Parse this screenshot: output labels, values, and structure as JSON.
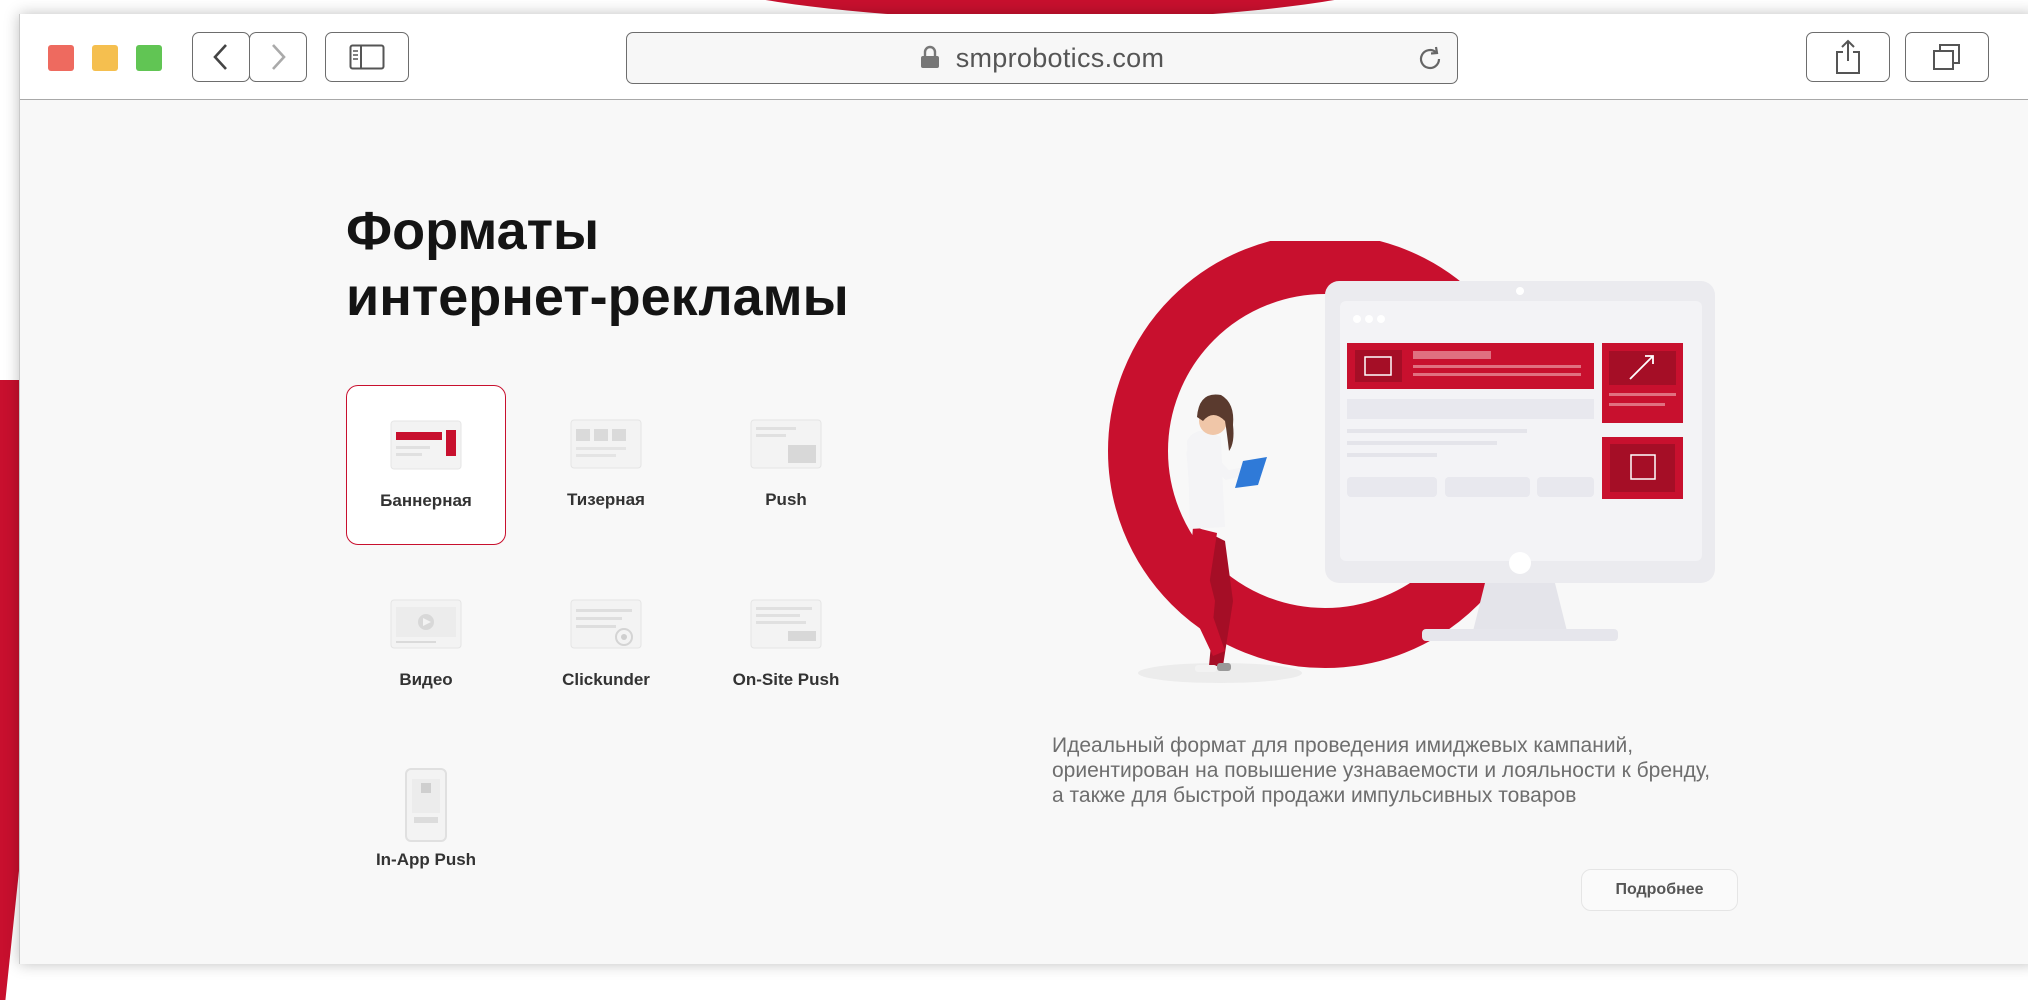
{
  "browser": {
    "url": "smprobotics.com",
    "traffic_lights": [
      "#ee6a5f",
      "#f5bf4f",
      "#61c554"
    ]
  },
  "page": {
    "title_line1": "Форматы",
    "title_line2": "интернет-рекламы",
    "formats": [
      {
        "label": "Баннерная",
        "selected": true
      },
      {
        "label": "Тизерная",
        "selected": false
      },
      {
        "label": "Push",
        "selected": false
      },
      {
        "label": "Видео",
        "selected": false
      },
      {
        "label": "Clickunder",
        "selected": false
      },
      {
        "label": "On-Site Push",
        "selected": false
      },
      {
        "label": "In-App Push",
        "selected": false
      }
    ],
    "description": [
      "Идеальный формат для проведения имиджевых кампаний,",
      "ориентирован на повышение узнаваемости и лояльности к бренду,",
      "а также для быстрой продажи импульсивных товаров"
    ],
    "more_button": "Подробнее"
  },
  "colors": {
    "accent": "#c8102e",
    "accent_dark": "#a50e26"
  }
}
